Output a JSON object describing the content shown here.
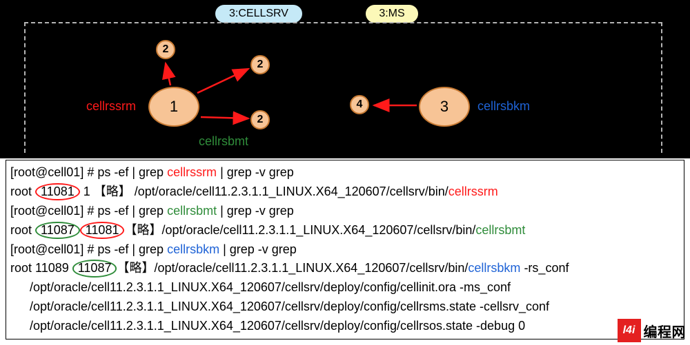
{
  "header": {
    "cellsrv_pill": "3:CELLSRV",
    "ms_pill": "3:MS"
  },
  "diagram": {
    "big1": "1",
    "big3": "3",
    "sc_top": "2",
    "sc_right": "2",
    "sc_two": "2",
    "sc_four": "4",
    "label_ssrm": "cellrssrm",
    "label_sbmt": "cellrsbmt",
    "label_sbkm": "cellrsbkm"
  },
  "terminal": {
    "cmd1": {
      "prompt": "[root@cell01] # ps -ef | grep ",
      "proc": "cellrssrm",
      "suffix": " | grep -v grep"
    },
    "out1": {
      "pre": "root    ",
      "pid": "11081",
      "mid": "      1 【略】   /opt/oracle/cell11.2.3.1.1_LINUX.X64_120607/cellsrv/bin/",
      "proc": "cellrssrm"
    },
    "cmd2": {
      "prompt": "[root@cell01] # ps -ef | grep ",
      "proc": "cellrsbmt",
      "suffix": " | grep -v grep"
    },
    "out2": {
      "pre": "root    ",
      "pid": "11087",
      "ppid": "11081",
      "mid": "【略】/opt/oracle/cell11.2.3.1.1_LINUX.X64_120607/cellsrv/bin/",
      "proc": "cellrsbmt"
    },
    "cmd3": {
      "prompt": "[root@cell01] # ps -ef | grep ",
      "proc": "cellrsbkm",
      "suffix": " | grep -v grep"
    },
    "out3": {
      "pre": "root      11089 ",
      "ppid": "11087",
      "mid": "【略】/opt/oracle/cell11.2.3.1.1_LINUX.X64_120607/cellsrv/bin/",
      "proc": "cellrsbkm",
      "tail": " -rs_conf",
      "c1": "/opt/oracle/cell11.2.3.1.1_LINUX.X64_120607/cellsrv/deploy/config/cellinit.ora -ms_conf",
      "c2": "/opt/oracle/cell11.2.3.1.1_LINUX.X64_120607/cellsrv/deploy/config/cellrsms.state -cellsrv_conf",
      "c3": "/opt/oracle/cell11.2.3.1.1_LINUX.X64_120607/cellsrv/deploy/config/cellrsos.state -debug 0"
    }
  },
  "watermark": {
    "logo": "l4i",
    "text": "编程网"
  },
  "chart_data": {
    "type": "diagram",
    "title": "Exadata cell process hierarchy",
    "pills": [
      "3:CELLSRV",
      "3:MS"
    ],
    "nodes": [
      {
        "id": "1",
        "label": "cellrssrm"
      },
      {
        "id": "2a",
        "label": ""
      },
      {
        "id": "2b",
        "label": ""
      },
      {
        "id": "2c",
        "label": "cellrsbmt"
      },
      {
        "id": "3",
        "label": "cellrsbkm"
      },
      {
        "id": "4",
        "label": ""
      }
    ],
    "edges": [
      {
        "from": "1",
        "to": "2a"
      },
      {
        "from": "1",
        "to": "2b"
      },
      {
        "from": "1",
        "to": "2c"
      },
      {
        "from": "3",
        "to": "4"
      }
    ],
    "process_table": [
      {
        "proc": "cellrssrm",
        "pid": 11081,
        "ppid": 1,
        "bin": "/opt/oracle/cell11.2.3.1.1_LINUX.X64_120607/cellsrv/bin/cellrssrm"
      },
      {
        "proc": "cellrsbmt",
        "pid": 11087,
        "ppid": 11081,
        "bin": "/opt/oracle/cell11.2.3.1.1_LINUX.X64_120607/cellsrv/bin/cellrsbmt"
      },
      {
        "proc": "cellrsbkm",
        "pid": 11089,
        "ppid": 11087,
        "bin": "/opt/oracle/cell11.2.3.1.1_LINUX.X64_120607/cellsrv/bin/cellrsbkm",
        "args": "-rs_conf /opt/oracle/cell11.2.3.1.1_LINUX.X64_120607/cellsrv/deploy/config/cellinit.ora -ms_conf /opt/oracle/cell11.2.3.1.1_LINUX.X64_120607/cellsrv/deploy/config/cellrsms.state -cellsrv_conf /opt/oracle/cell11.2.3.1.1_LINUX.X64_120607/cellsrv/deploy/config/cellrsos.state -debug 0"
      }
    ]
  }
}
